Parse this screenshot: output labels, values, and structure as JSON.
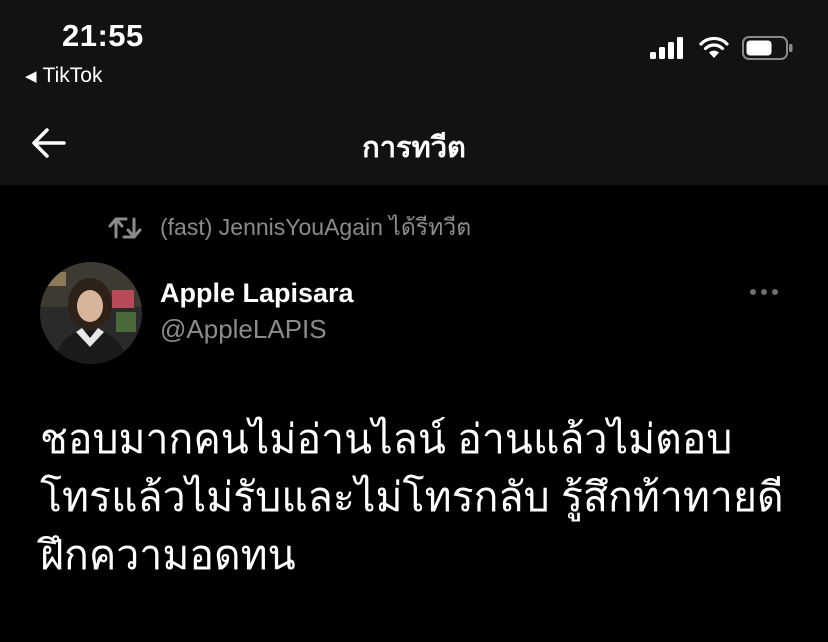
{
  "status_bar": {
    "time": "21:55",
    "back_app_label": "TikTok"
  },
  "nav": {
    "title": "การทวีต"
  },
  "retweet": {
    "label": "(fast) JennisYouAgain ได้รีทวีต"
  },
  "tweet": {
    "author_name": "Apple Lapisara",
    "author_handle": "@AppleLAPIS",
    "lines": [
      "ชอบมากคนไม่อ่านไลน์ อ่านแล้วไม่ตอบ",
      "โทรแล้วไม่รับและไม่โทรกลับ รู้สึกท้าทายดี",
      "ฝึกความอดทน"
    ]
  },
  "icons": {
    "back_app": "caret-left-icon",
    "signal": "cellular-signal-icon",
    "wifi": "wifi-icon",
    "battery": "battery-icon",
    "back": "arrow-left-icon",
    "retweet": "retweet-icon",
    "more": "more-dots-icon"
  },
  "colors": {
    "background": "#000000",
    "bar": "#121212",
    "muted": "#8b8b8b"
  }
}
